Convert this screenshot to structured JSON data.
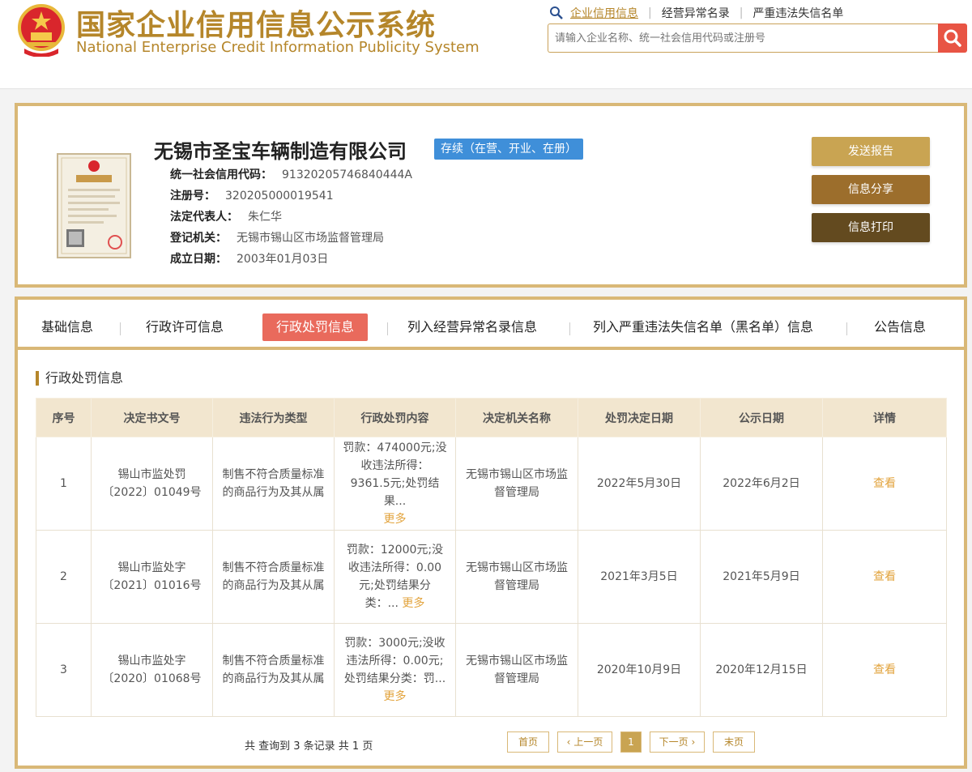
{
  "header": {
    "title_cn": "国家企业信用信息公示系统",
    "title_en": "National Enterprise Credit Information Publicity System",
    "links": [
      "企业信用信息",
      "经营异常名录",
      "严重违法失信名单"
    ],
    "search_placeholder": "请输入企业名称、统一社会信用代码或注册号",
    "accent_color": "#b5862a",
    "search_button_color": "#e85444"
  },
  "company": {
    "name": "无锡市圣宝车辆制造有限公司",
    "status": "存续（在营、开业、在册）",
    "credit_code_label": "统一社会信用代码：",
    "credit_code": "91320205746840444A",
    "reg_no_label": "注册号：",
    "reg_no": "320205000019541",
    "legal_rep_label": "法定代表人：",
    "legal_rep": "朱仁华",
    "authority_label": "登记机关：",
    "authority": "无锡市锡山区市场监督管理局",
    "founded_label": "成立日期：",
    "founded": "2003年01月03日",
    "buttons": {
      "send": "发送报告",
      "share": "信息分享",
      "print": "信息打印"
    }
  },
  "tabs": [
    "基础信息",
    "行政许可信息",
    "行政处罚信息",
    "列入经营异常名录信息",
    "列入严重违法失信名单（黑名单）信息",
    "公告信息"
  ],
  "active_tab": 2,
  "section_title": "行政处罚信息",
  "table": {
    "headers": [
      "序号",
      "决定书文号",
      "违法行为类型",
      "行政处罚内容",
      "决定机关名称",
      "处罚决定日期",
      "公示日期",
      "详情"
    ],
    "rows": [
      {
        "no": "1",
        "doc_no": "锡山市监处罚〔2022〕01049号",
        "type": "制售不符合质量标准的商品行为及其从属",
        "content": "罚款：474000元;没收违法所得：9361.5元;处罚结果...",
        "more": "更多",
        "org": "无锡市锡山区市场监督管理局",
        "decision_date": "2022年5月30日",
        "publish_date": "2022年6月2日",
        "detail": "查看"
      },
      {
        "no": "2",
        "doc_no": "锡山市监处字〔2021〕01016号",
        "type": "制售不符合质量标准的商品行为及其从属",
        "content": "罚款：12000元;没收违法所得：0.00元;处罚结果分类：...",
        "more": "更多",
        "org": "无锡市锡山区市场监督管理局",
        "decision_date": "2021年3月5日",
        "publish_date": "2021年5月9日",
        "detail": "查看"
      },
      {
        "no": "3",
        "doc_no": "锡山市监处字〔2020〕01068号",
        "type": "制售不符合质量标准的商品行为及其从属",
        "content": "罚款：3000元;没收违法所得：0.00元;处罚结果分类：罚...",
        "more": "更多",
        "org": "无锡市锡山区市场监督管理局",
        "decision_date": "2020年10月9日",
        "publish_date": "2020年12月15日",
        "detail": "查看"
      }
    ]
  },
  "pager": {
    "info": "共 查询到 3 条记录 共 1 页",
    "first": "首页",
    "prev": "上一页",
    "current": "1",
    "next": "下一页",
    "last": "末页"
  }
}
